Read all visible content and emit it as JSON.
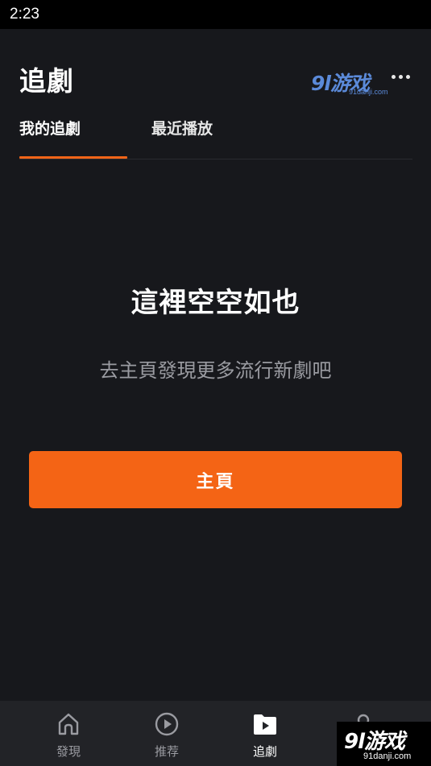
{
  "status_bar": {
    "time": "2:23"
  },
  "header": {
    "title": "追劇",
    "more_icon": "more-horizontal-icon"
  },
  "watermark_top": {
    "logo": "9l游戏",
    "sub": "91danji.com"
  },
  "tabs": [
    {
      "label": "我的追劇",
      "active": true
    },
    {
      "label": "最近播放",
      "active": false
    }
  ],
  "empty_state": {
    "title": "這裡空空如也",
    "subtitle": "去主頁發現更多流行新劇吧",
    "button_label": "主頁"
  },
  "bottom_nav": [
    {
      "label": "發現",
      "icon": "home-icon",
      "active": false
    },
    {
      "label": "推荐",
      "icon": "play-circle-icon",
      "active": false
    },
    {
      "label": "追劇",
      "icon": "folder-play-icon",
      "active": true
    },
    {
      "label": "",
      "icon": "profile-icon",
      "active": false
    }
  ],
  "watermark_bottom": {
    "logo": "9l游戏",
    "sub": "91danji.com"
  },
  "colors": {
    "accent": "#f46415",
    "background": "#17181c",
    "nav_background": "#222327",
    "secondary_text": "#9a9ba1"
  }
}
